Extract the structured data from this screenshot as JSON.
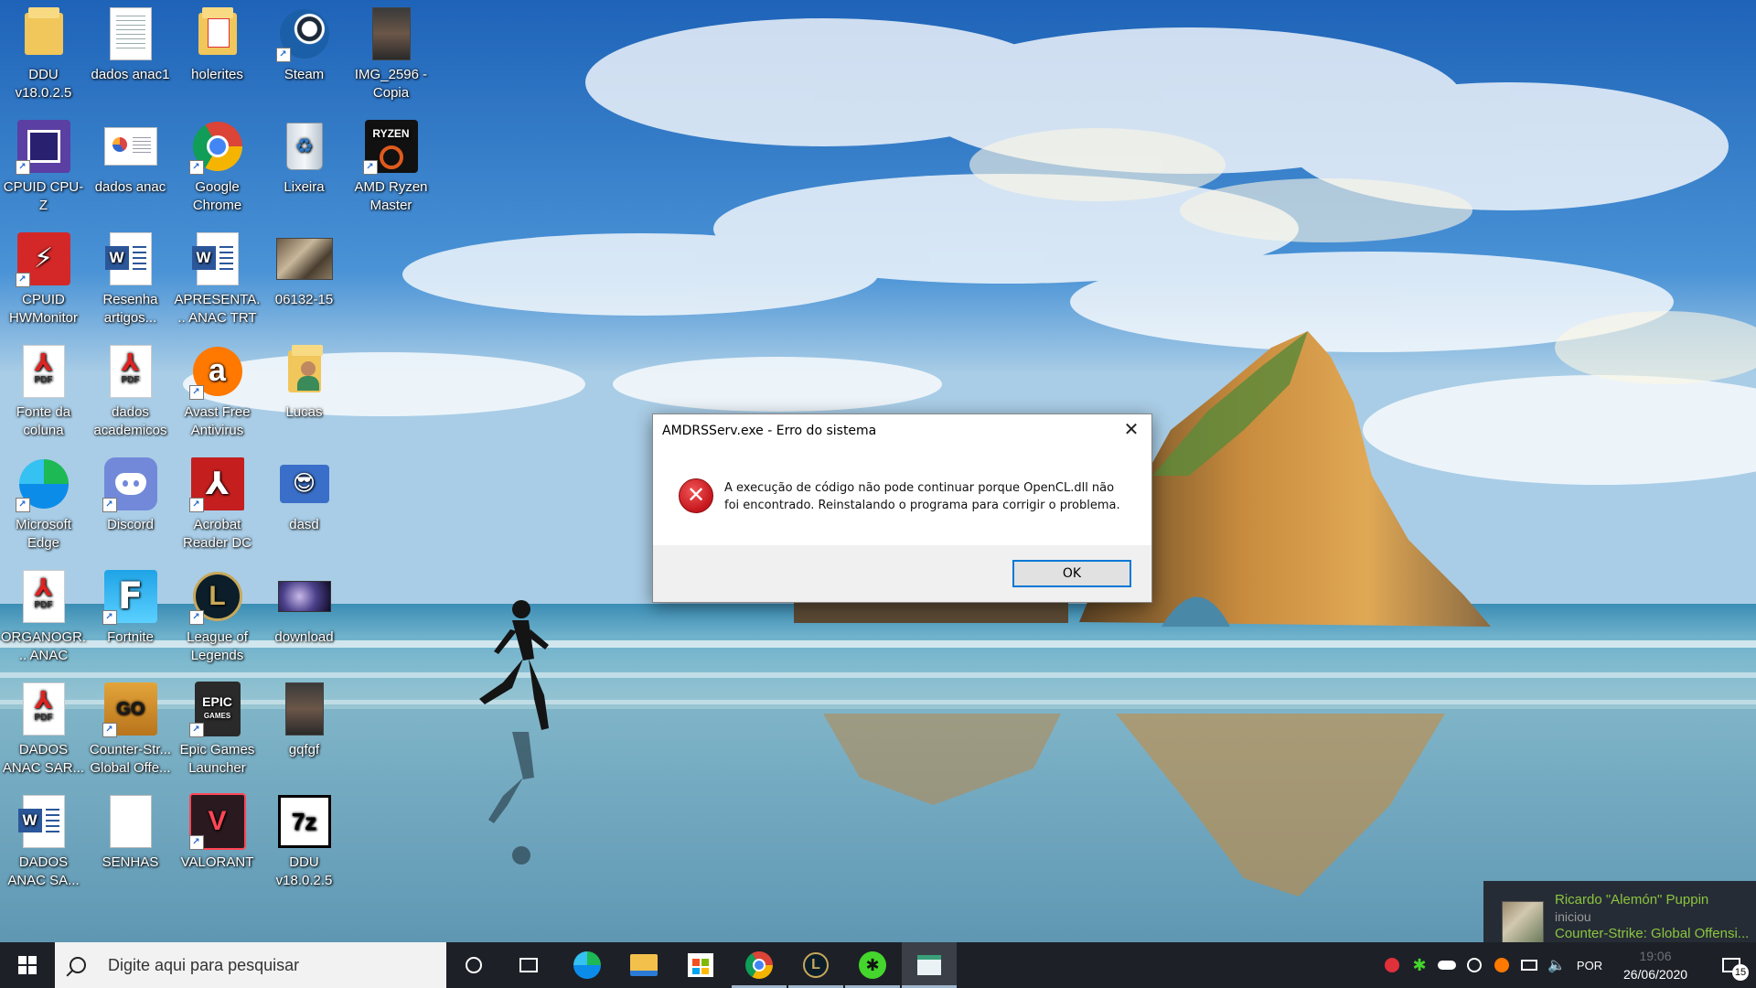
{
  "desktop": {
    "icons": [
      {
        "label": "DDU v18.0.2.5",
        "icon": "folder-icon"
      },
      {
        "label": "dados anac1",
        "icon": "text-document-icon"
      },
      {
        "label": "holerites",
        "icon": "pdf-folder-icon"
      },
      {
        "label": "Steam",
        "icon": "steam-icon"
      },
      {
        "label": "IMG_2596 - Copia",
        "icon": "photo-icon"
      },
      {
        "label": "CPUID CPU-Z",
        "icon": "cpu-z-icon"
      },
      {
        "label": "dados anac",
        "icon": "chart-document-icon"
      },
      {
        "label": "Google Chrome",
        "icon": "chrome-icon"
      },
      {
        "label": "Lixeira",
        "icon": "recycle-bin-icon"
      },
      {
        "label": "AMD Ryzen Master",
        "icon": "ryzen-master-icon"
      },
      {
        "label": "CPUID HWMonitor",
        "icon": "hwmonitor-icon"
      },
      {
        "label": "Resenha artigos...",
        "icon": "word-document-icon"
      },
      {
        "label": "APRESENTA... ANAC TRT",
        "icon": "word-document-icon"
      },
      {
        "label": "06132-15",
        "icon": "photo-icon"
      },
      {
        "label": "Fonte da coluna",
        "icon": "pdf-icon"
      },
      {
        "label": "dados academicos",
        "icon": "pdf-icon"
      },
      {
        "label": "Avast Free Antivirus",
        "icon": "avast-icon"
      },
      {
        "label": "Lucas",
        "icon": "user-folder-icon"
      },
      {
        "label": "Microsoft Edge",
        "icon": "edge-icon"
      },
      {
        "label": "Discord",
        "icon": "discord-icon"
      },
      {
        "label": "Acrobat Reader DC",
        "icon": "acrobat-icon"
      },
      {
        "label": "dasd",
        "icon": "image-icon"
      },
      {
        "label": "ORGANOGR... ANAC",
        "icon": "pdf-icon"
      },
      {
        "label": "Fortnite",
        "icon": "fortnite-icon"
      },
      {
        "label": "League of Legends",
        "icon": "league-of-legends-icon"
      },
      {
        "label": "download",
        "icon": "image-icon"
      },
      {
        "label": "DADOS ANAC SAR...",
        "icon": "pdf-icon"
      },
      {
        "label": "Counter-Str... Global Offe...",
        "icon": "csgo-icon"
      },
      {
        "label": "Epic Games Launcher",
        "icon": "epic-games-icon"
      },
      {
        "label": "gqfgf",
        "icon": "photo-icon"
      },
      {
        "label": "DADOS ANAC SA...",
        "icon": "word-document-icon"
      },
      {
        "label": "SENHAS",
        "icon": "blank-document-icon"
      },
      {
        "label": "VALORANT",
        "icon": "valorant-icon"
      },
      {
        "label": "DDU v18.0.2.5",
        "icon": "7zip-archive-icon"
      }
    ]
  },
  "dialog": {
    "title": "AMDRSServ.exe - Erro do sistema",
    "message": "A execução de código não pode continuar porque OpenCL.dll não foi encontrado. Reinstalando o programa para corrigir o problema.",
    "ok_label": "OK",
    "icon": "error-icon",
    "close_glyph": "✕"
  },
  "notification": {
    "name": "Ricardo \"Alemón\" Puppin",
    "action": "iniciou",
    "game": "Counter-Strike: Global Offensi..."
  },
  "taskbar": {
    "search_placeholder": "Digite aqui para pesquisar",
    "apps": [
      "cortana-icon",
      "task-view-icon",
      "edge-icon",
      "file-explorer-icon",
      "microsoft-store-icon",
      "chrome-icon",
      "league-of-legends-icon",
      "razer-icon",
      "window-icon"
    ],
    "language": "POR",
    "time": "19:06",
    "date": "26/06/2020",
    "notification_count": "15"
  },
  "colors": {
    "taskbar_bg": "#1d2027",
    "dialog_accent": "#0078d7",
    "error_red": "#c4161c",
    "steam_green": "#8bc53f"
  }
}
